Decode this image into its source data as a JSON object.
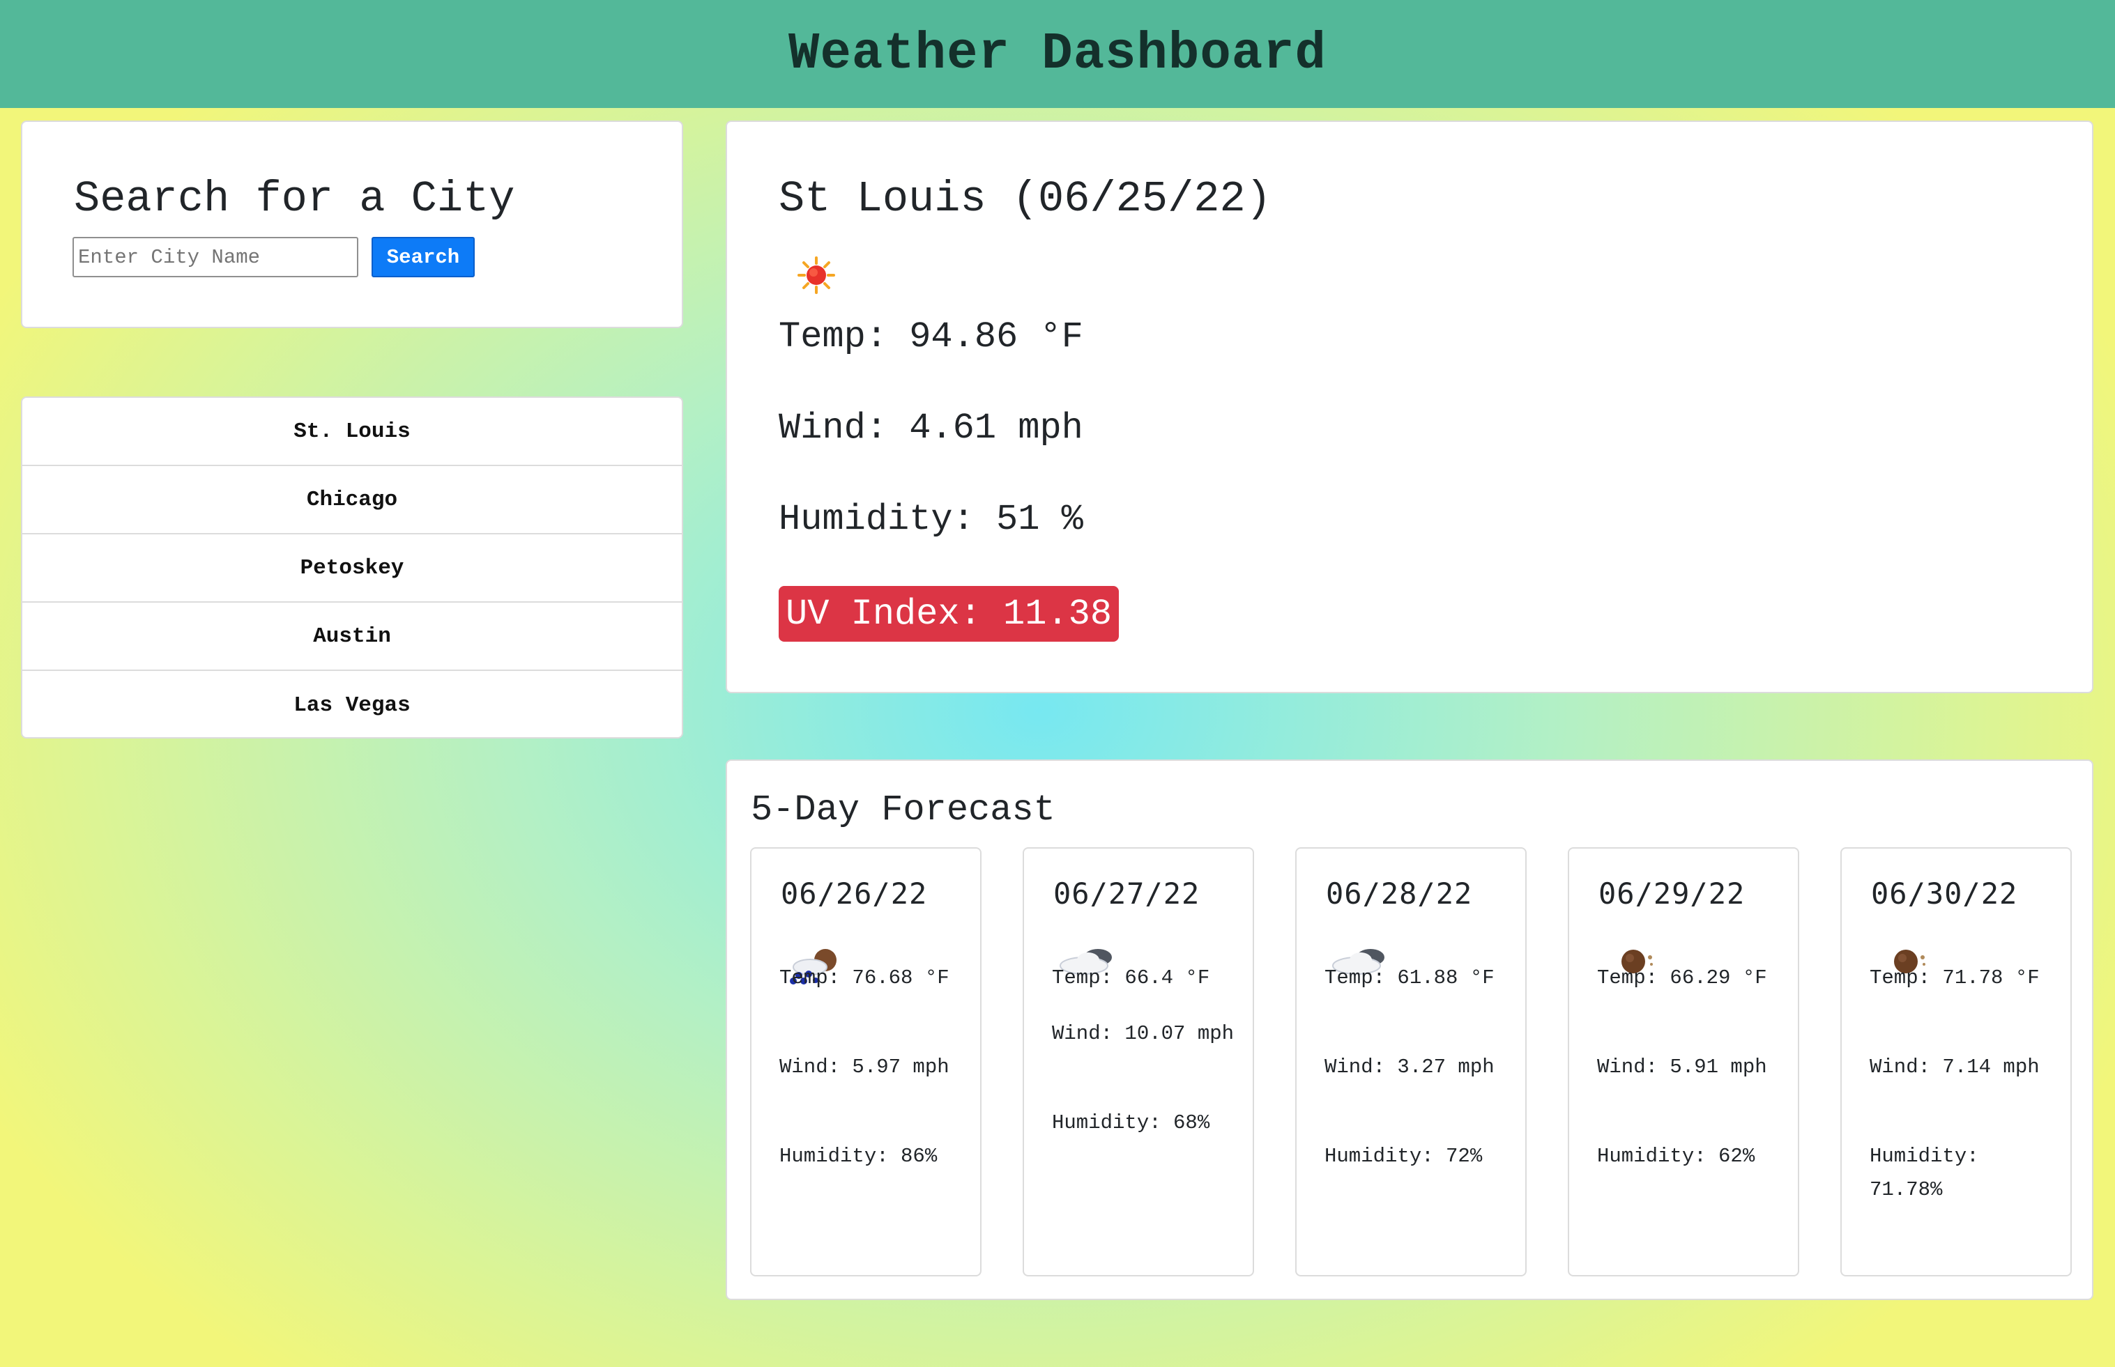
{
  "header": {
    "title": "Weather Dashboard"
  },
  "search": {
    "title": "Search for a City",
    "placeholder": "Enter City Name",
    "button_label": "Search"
  },
  "history": [
    "St. Louis",
    "Chicago",
    "Petoskey",
    "Austin",
    "Las Vegas"
  ],
  "current": {
    "title": "St Louis (06/25/22)",
    "icon": "sun-icon",
    "temp": "Temp: 94.86 °F",
    "wind": "Wind: 4.61 mph",
    "humidity": "Humidity: 51 %",
    "uv": "UV Index: 11.38",
    "uv_color": "#dc3545"
  },
  "forecast": {
    "title": "5-Day Forecast",
    "days": [
      {
        "date": "06/26/22",
        "icon": "rain-icon",
        "temp": "Temp: 76.68 °F",
        "wind": "Wind: 5.97 mph",
        "humidity": "Humidity: 86%"
      },
      {
        "date": "06/27/22",
        "icon": "cloud-icon",
        "temp": "Temp: 66.4 °F",
        "wind": "Wind: 10.07 mph",
        "humidity": "Humidity: 68%"
      },
      {
        "date": "06/28/22",
        "icon": "cloud-icon",
        "temp": "Temp: 61.88 °F",
        "wind": "Wind: 3.27 mph",
        "humidity": "Humidity: 72%"
      },
      {
        "date": "06/29/22",
        "icon": "clear-night-icon",
        "temp": "Temp: 66.29 °F",
        "wind": "Wind: 5.91 mph",
        "humidity": "Humidity: 62%"
      },
      {
        "date": "06/30/22",
        "icon": "clear-night-icon",
        "temp": "Temp: 71.78 °F",
        "wind": "Wind: 7.14 mph",
        "humidity": "Humidity: 71.78%"
      }
    ]
  },
  "colors": {
    "header": "#53b899",
    "accent": "#0d7bf7",
    "uv_high": "#dc3545"
  }
}
